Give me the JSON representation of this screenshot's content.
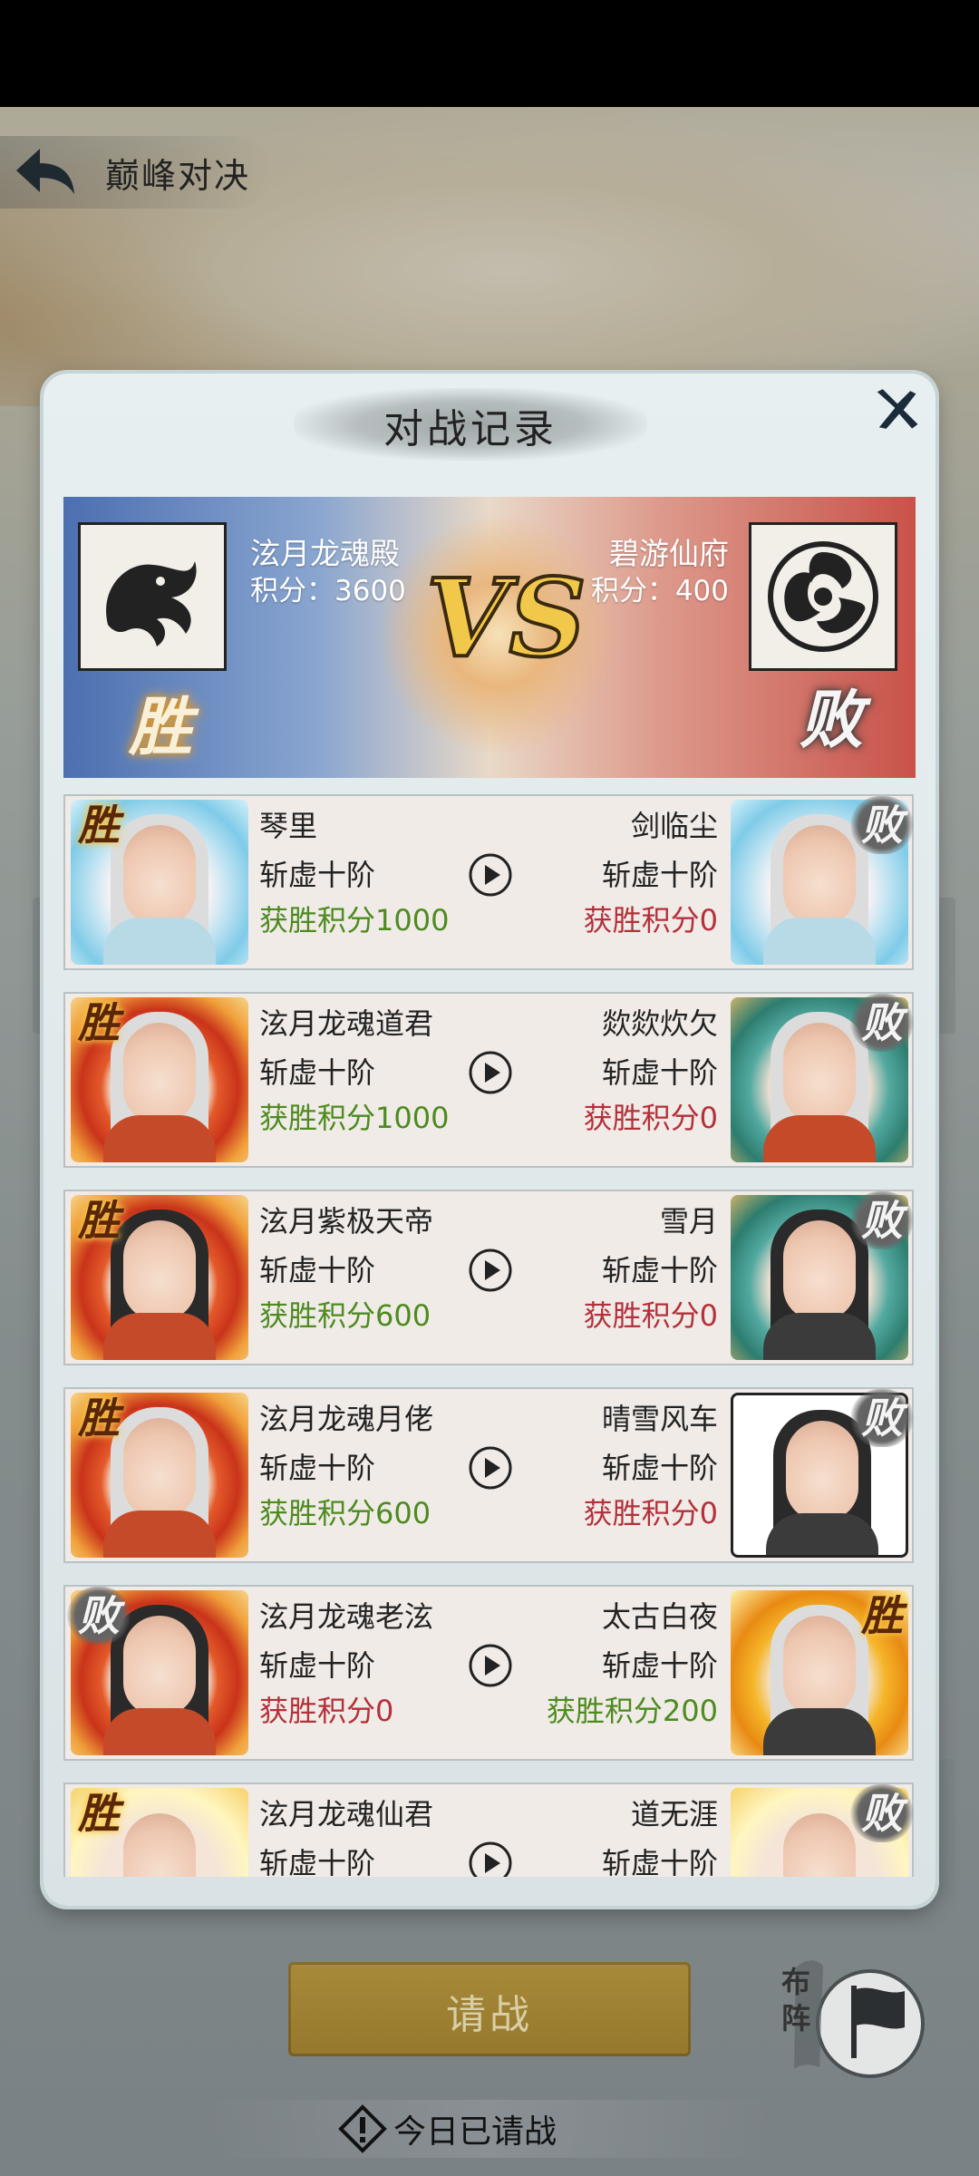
{
  "header": {
    "title": "巅峰对决"
  },
  "modal": {
    "title": "对战记录"
  },
  "summary": {
    "left": {
      "guild": "泫月龙魂殿",
      "score": "积分：3600",
      "result": "胜"
    },
    "right": {
      "guild": "碧游仙府",
      "score": "积分：400",
      "result": "败"
    },
    "vs": "VS"
  },
  "records": [
    {
      "left": {
        "name": "琴里",
        "rank": "斩虚十阶",
        "score": "获胜积分1000",
        "result": "胜"
      },
      "right": {
        "name": "剑临尘",
        "rank": "斩虚十阶",
        "score": "获胜积分0",
        "result": "败"
      }
    },
    {
      "left": {
        "name": "泫月龙魂道君",
        "rank": "斩虚十阶",
        "score": "获胜积分1000",
        "result": "胜"
      },
      "right": {
        "name": "欻欻炊欠",
        "rank": "斩虚十阶",
        "score": "获胜积分0",
        "result": "败"
      }
    },
    {
      "left": {
        "name": "泫月紫极天帝",
        "rank": "斩虚十阶",
        "score": "获胜积分600",
        "result": "胜"
      },
      "right": {
        "name": "雪月",
        "rank": "斩虚十阶",
        "score": "获胜积分0",
        "result": "败"
      }
    },
    {
      "left": {
        "name": "泫月龙魂月佬",
        "rank": "斩虚十阶",
        "score": "获胜积分600",
        "result": "胜"
      },
      "right": {
        "name": "晴雪风车",
        "rank": "斩虚十阶",
        "score": "获胜积分0",
        "result": "败"
      }
    },
    {
      "left": {
        "name": "泫月龙魂老泫",
        "rank": "斩虚十阶",
        "score": "获胜积分0",
        "result": "败"
      },
      "right": {
        "name": "太古白夜",
        "rank": "斩虚十阶",
        "score": "获胜积分200",
        "result": "胜"
      }
    },
    {
      "left": {
        "name": "泫月龙魂仙君",
        "rank": "斩虚十阶",
        "score": "",
        "result": "胜"
      },
      "right": {
        "name": "道无涯",
        "rank": "斩虚十阶",
        "score": "",
        "result": "败"
      }
    }
  ],
  "actions": {
    "fight": "请战",
    "formation": "布阵",
    "notice": "今日已请战"
  },
  "colors": {
    "win_score": "#4d8b1f",
    "lose_score": "#b4303a",
    "win_seal": "#f7c84a",
    "lose_seal": "#555555"
  }
}
